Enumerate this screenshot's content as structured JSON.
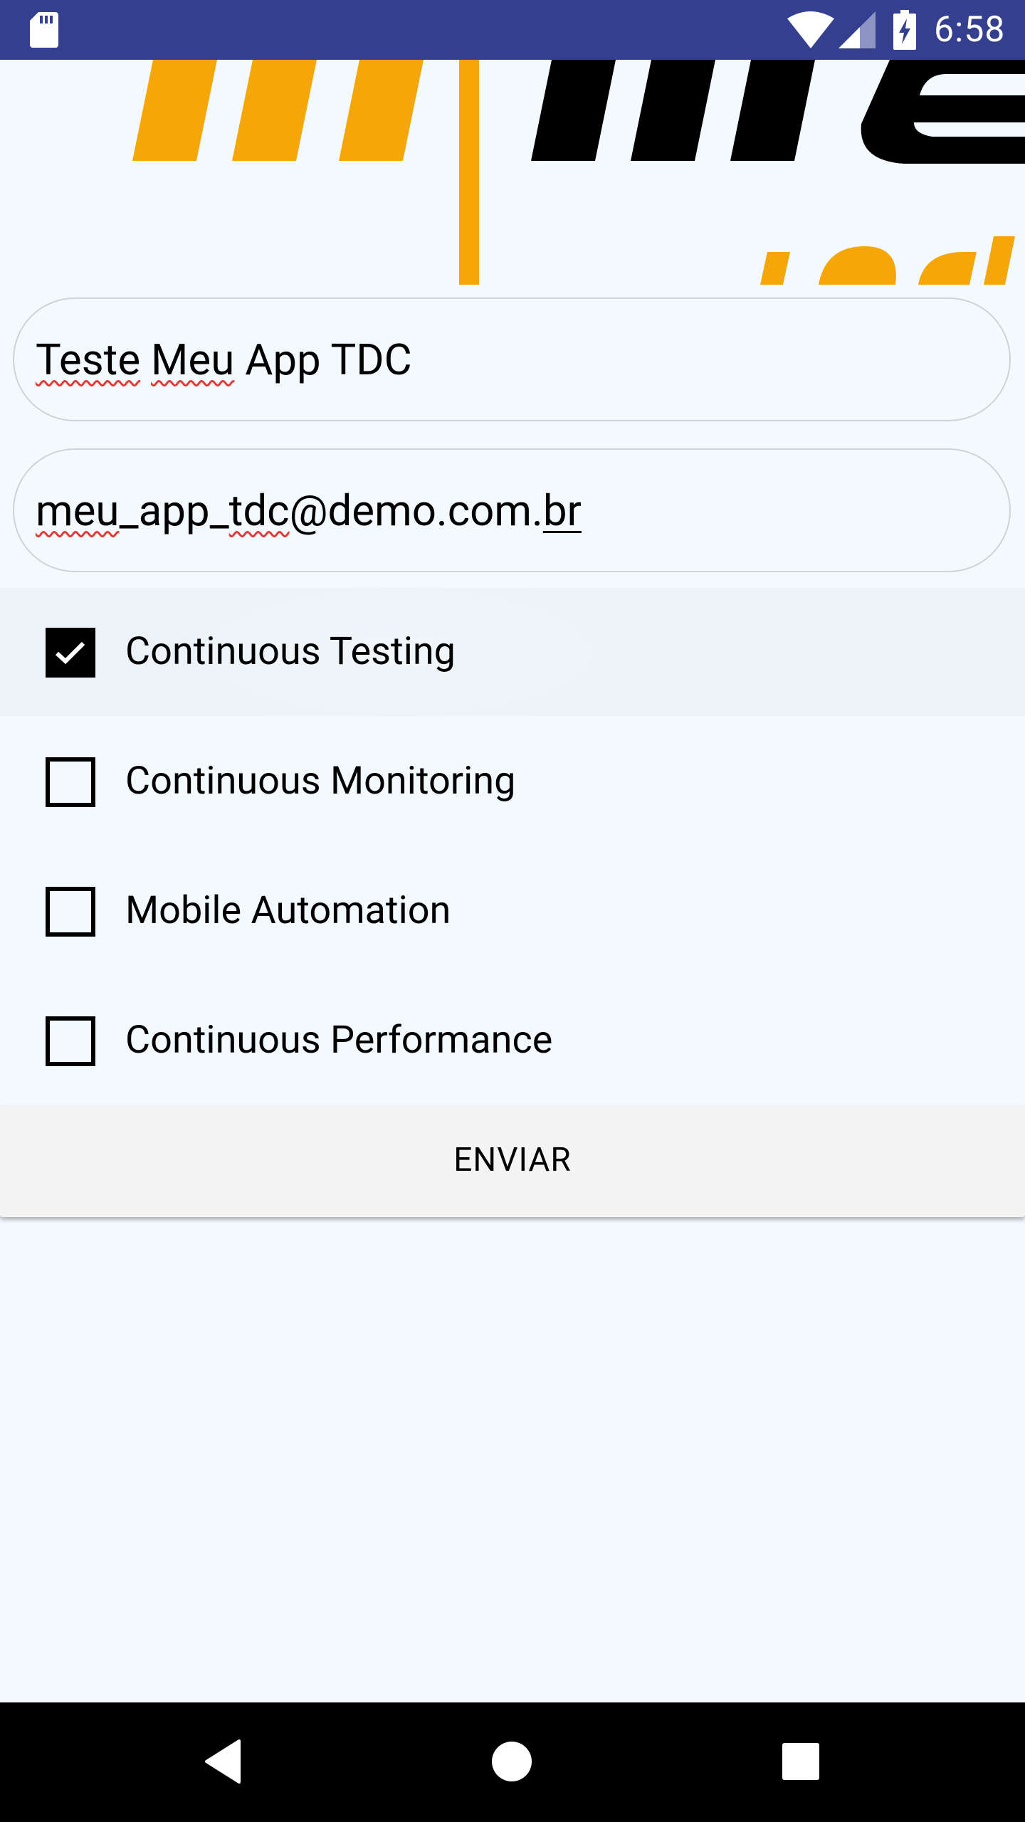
{
  "status_bar": {
    "time": "6:58",
    "icons": [
      "sd-card-icon",
      "wifi-icon",
      "signal-icon",
      "battery-charging-icon"
    ],
    "background": "#343f90"
  },
  "logo": {
    "colors": {
      "orange": "#f5a609",
      "black": "#000000"
    }
  },
  "form": {
    "name_field": {
      "words": [
        "Teste",
        "Meu",
        "App TDC"
      ]
    },
    "email_field": {
      "parts": [
        "meu",
        "_app_",
        "tdc",
        "@demo.com.",
        "br"
      ]
    },
    "options": [
      {
        "label": "Continuous Testing",
        "checked": true
      },
      {
        "label": "Continuous Monitoring",
        "checked": false
      },
      {
        "label": "Mobile Automation",
        "checked": false
      },
      {
        "label": "Continuous Performance",
        "checked": false
      }
    ],
    "submit_label": "ENVIAR"
  },
  "nav_bar": {
    "icons": [
      "back-icon",
      "home-icon",
      "recents-icon"
    ]
  }
}
